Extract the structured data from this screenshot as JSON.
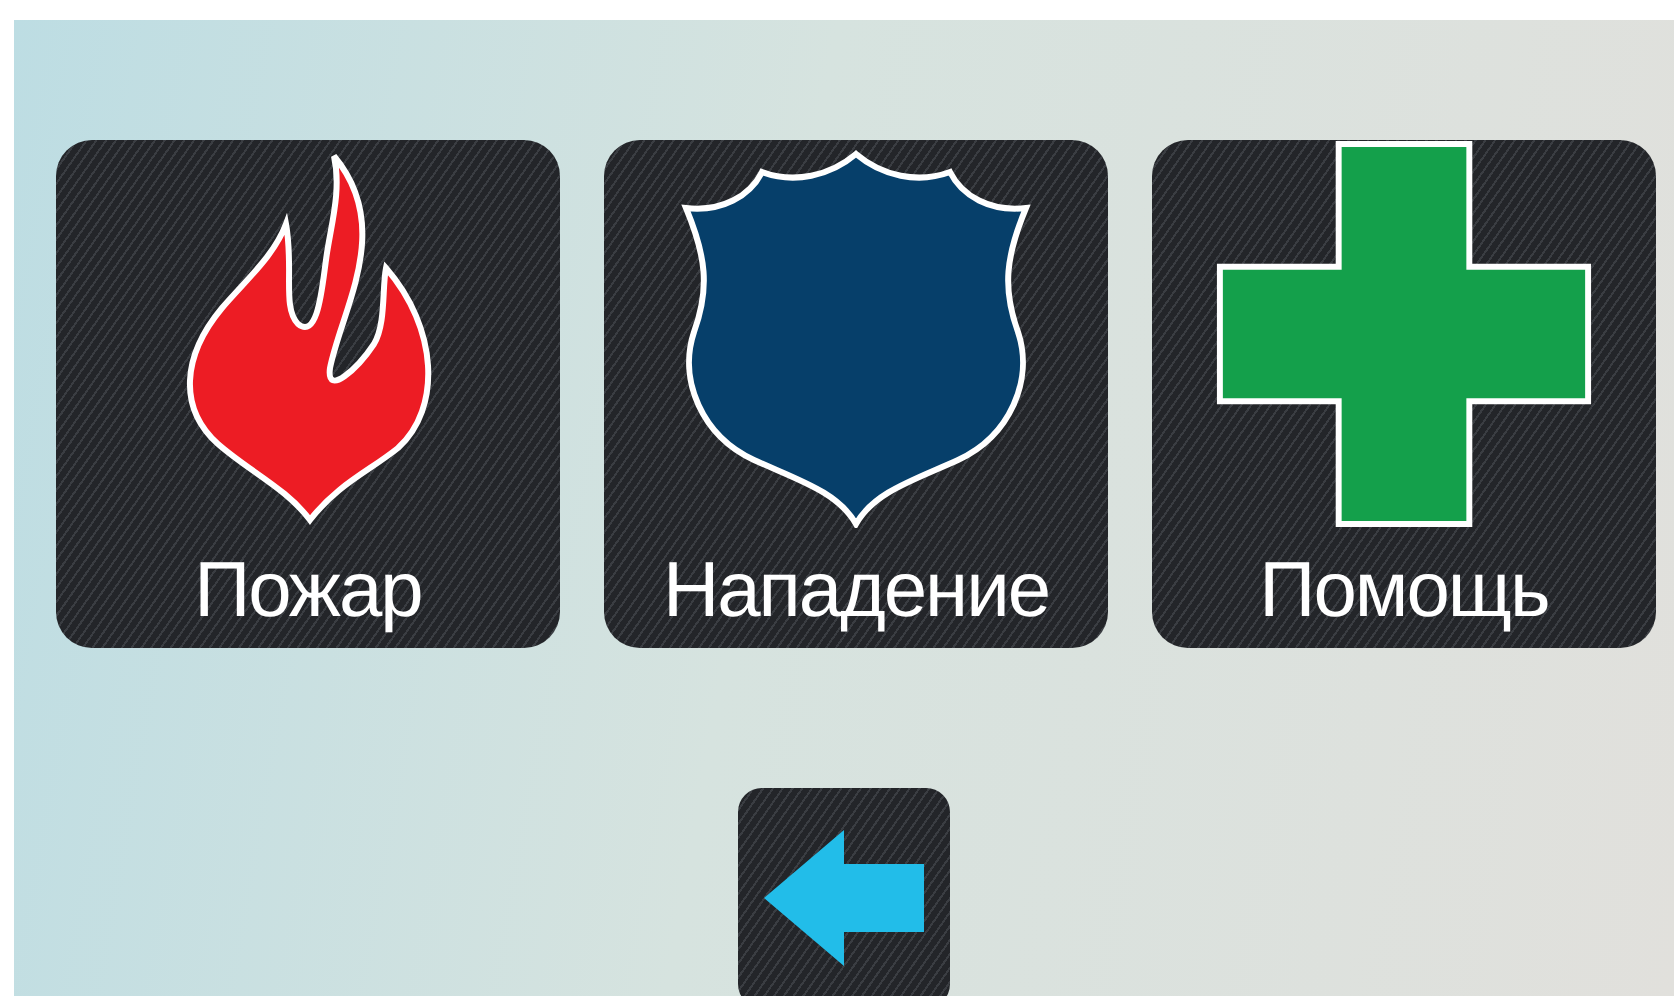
{
  "tiles": [
    {
      "kind": "fire",
      "label": "Пожар"
    },
    {
      "kind": "police",
      "label": "Нападение"
    },
    {
      "kind": "medical",
      "label": "Помощь"
    }
  ],
  "navigation": {
    "kind": "back"
  }
}
